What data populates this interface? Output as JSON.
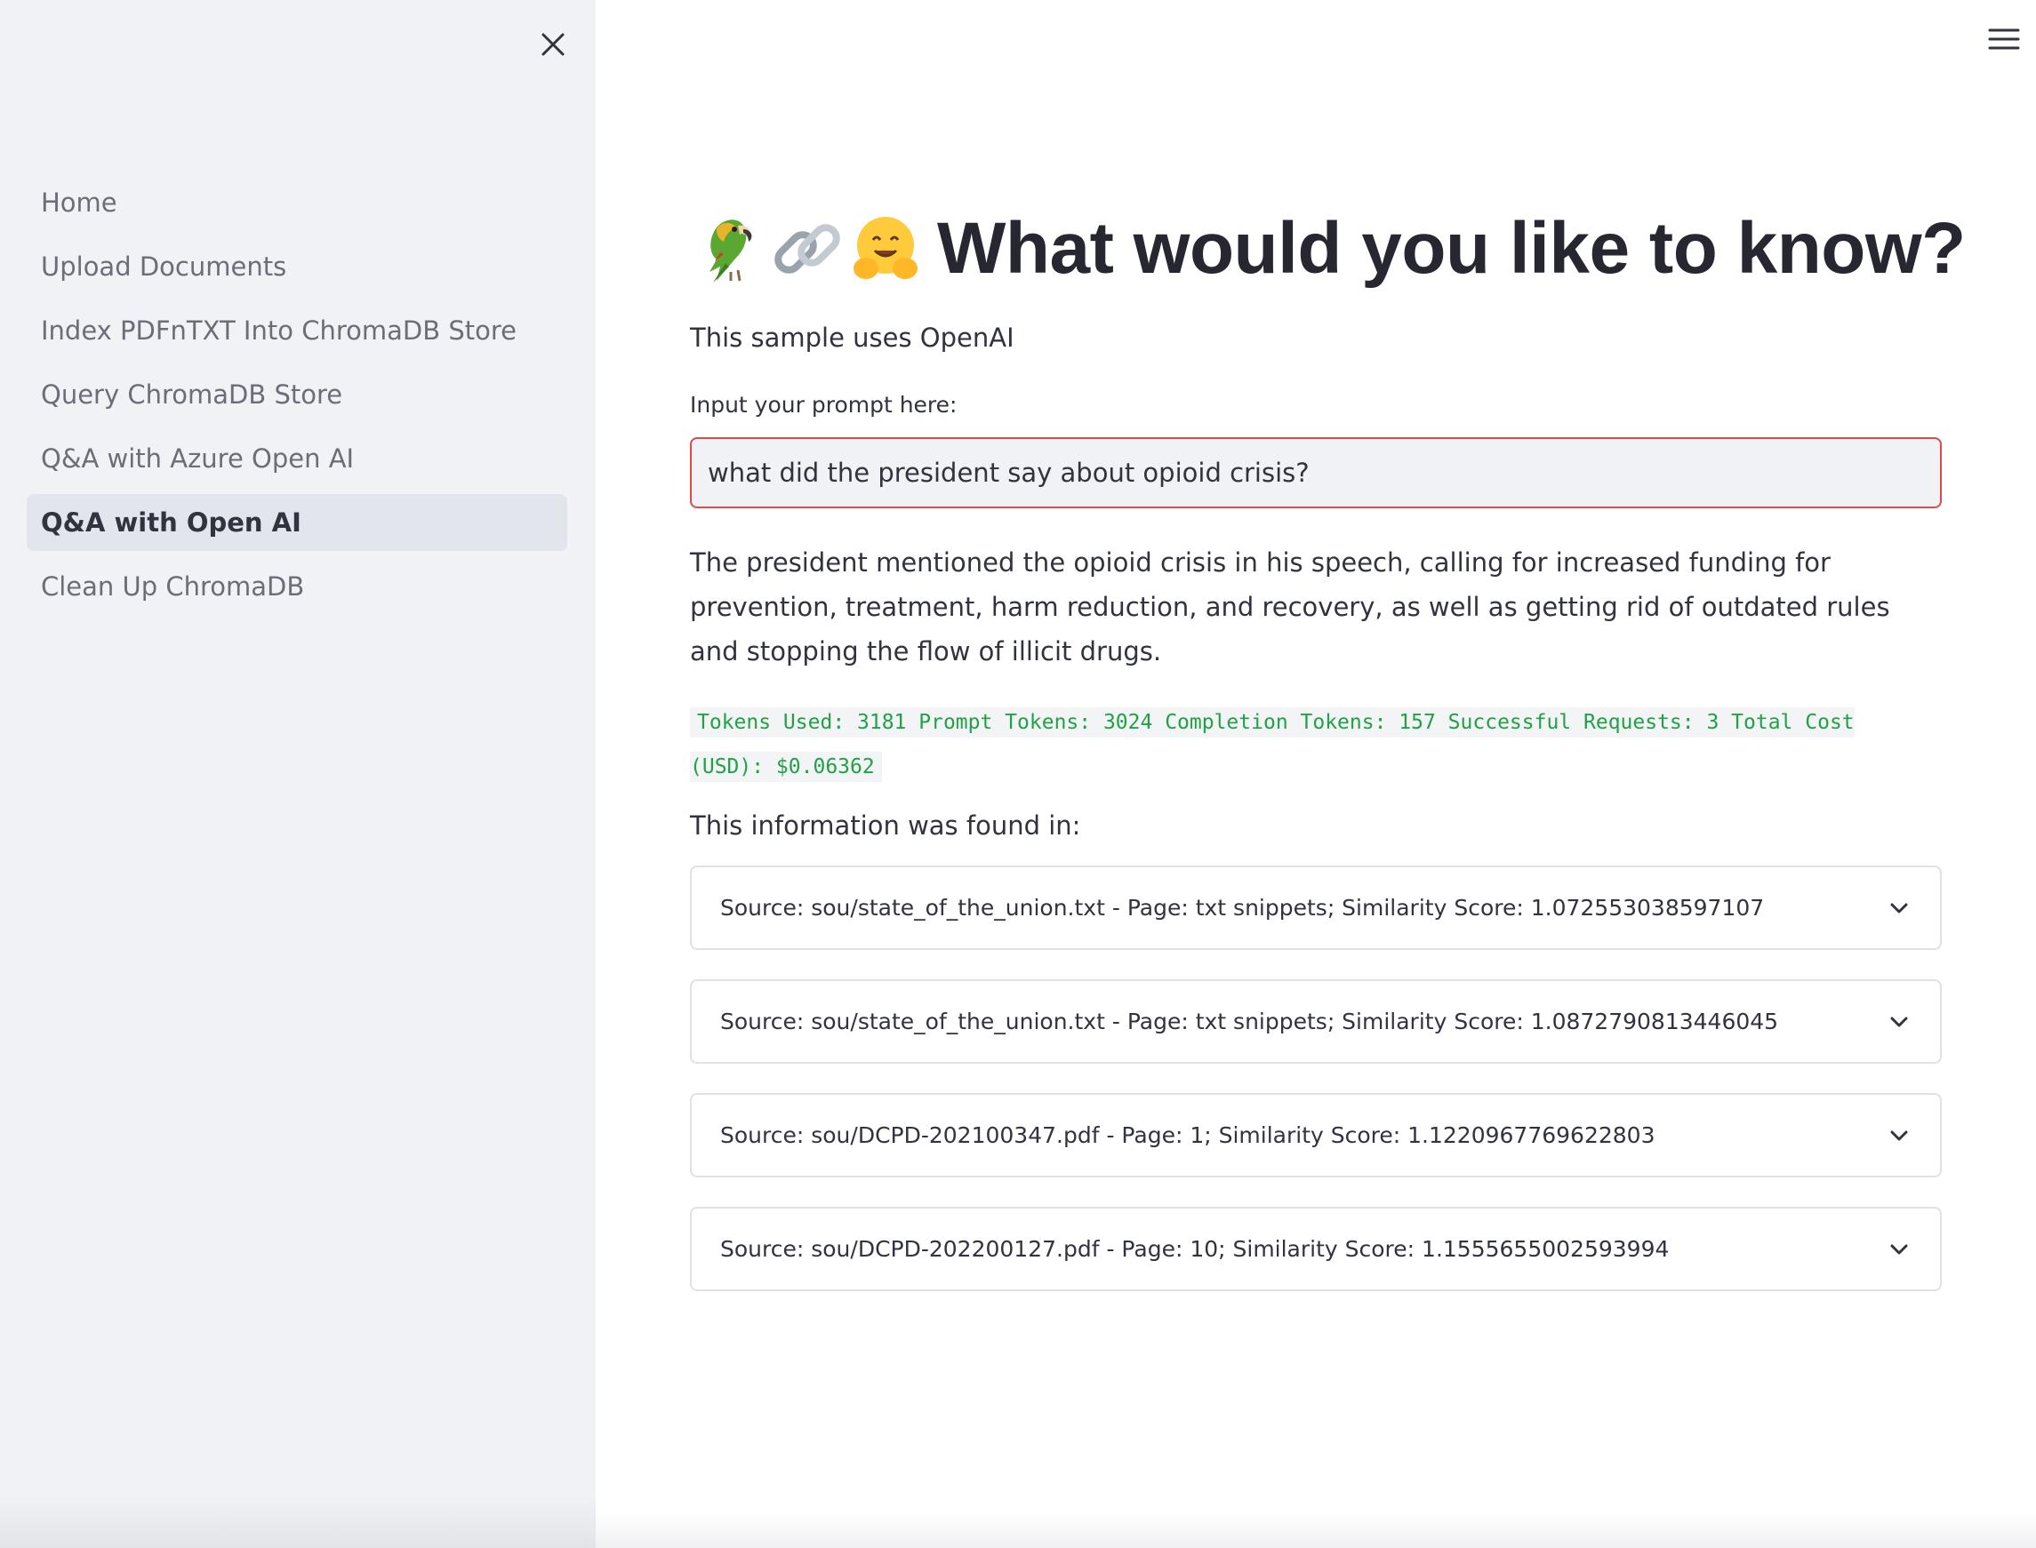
{
  "sidebar": {
    "items": [
      {
        "label": "Home",
        "active": false
      },
      {
        "label": "Upload Documents",
        "active": false
      },
      {
        "label": "Index PDFnTXT Into ChromaDB Store",
        "active": false
      },
      {
        "label": "Query ChromaDB Store",
        "active": false
      },
      {
        "label": "Q&A with Azure Open AI",
        "active": false
      },
      {
        "label": "Q&A with Open AI",
        "active": true
      },
      {
        "label": "Clean Up ChromaDB",
        "active": false
      }
    ],
    "close_icon": "close-icon"
  },
  "header": {
    "menu_icon": "hamburger-menu-icon"
  },
  "main": {
    "title_emojis": [
      "parrot",
      "link",
      "hugging-face"
    ],
    "title": "What would you like to know?",
    "subtitle": "This sample uses OpenAI",
    "input_label": "Input your prompt here:",
    "input_value": "what did the president say about opioid crisis?",
    "answer": "The president mentioned the opioid crisis in his speech, calling for increased funding for prevention, treatment, harm reduction, and recovery, as well as getting rid of outdated rules and stopping the flow of illicit drugs.",
    "stats": "Tokens Used: 3181 Prompt Tokens: 3024 Completion Tokens: 157 Successful Requests: 3 Total Cost (USD): $0.06362",
    "found_label": "This information was found in:",
    "sources": [
      {
        "label": "Source: sou/state_of_the_union.txt - Page: txt snippets; Similarity Score: 1.072553038597107"
      },
      {
        "label": "Source: sou/state_of_the_union.txt - Page: txt snippets; Similarity Score: 1.0872790813446045"
      },
      {
        "label": "Source: sou/DCPD-202100347.pdf - Page: 1; Similarity Score: 1.1220967769622803"
      },
      {
        "label": "Source: sou/DCPD-202200127.pdf - Page: 10; Similarity Score: 1.1555655002593994"
      }
    ]
  },
  "colors": {
    "sidebar_bg": "#f0f2f6",
    "active_item_bg": "#e2e5ec",
    "input_border": "#e04a4a",
    "stats_text": "#21a145"
  }
}
